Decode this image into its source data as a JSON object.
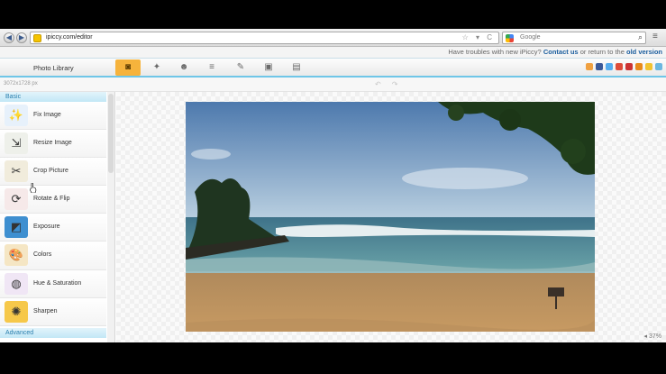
{
  "browser": {
    "back": "◀",
    "forward": "▶",
    "url": "ipiccy.com/editor",
    "url_icons": "☆ ▾ C",
    "search_placeholder": "Google",
    "menu": "≡"
  },
  "notice": {
    "prefix": "Have troubles with new iPiccy?",
    "contact": "Contact us",
    "middle": "or return to the",
    "old_version": "old version"
  },
  "toolbar": {
    "photo_library": "Photo Library",
    "tools": [
      {
        "icon": "camera-icon",
        "glyph": "◙"
      },
      {
        "icon": "magic-wand-icon",
        "glyph": "✦"
      },
      {
        "icon": "person-icon",
        "glyph": "☻"
      },
      {
        "icon": "layers-icon",
        "glyph": "≡"
      },
      {
        "icon": "stickers-icon",
        "glyph": "✎"
      },
      {
        "icon": "frame-icon",
        "glyph": "▣"
      },
      {
        "icon": "save-icon",
        "glyph": "▤"
      }
    ],
    "social_colors": [
      "#f0a040",
      "#3b5998",
      "#55acee",
      "#dd4b39",
      "#d44",
      "#e88a1a",
      "#f2c330",
      "#6bb7e0"
    ]
  },
  "info": {
    "dimensions": "3072x1728 px",
    "undo": "↶",
    "redo": "↷"
  },
  "sidebar": {
    "basic_label": "Basic",
    "advanced_label": "Advanced",
    "items": [
      {
        "label": "Fix Image",
        "icon": "sparkle-icon",
        "glyph": "✨",
        "bg": "#e7f1fb"
      },
      {
        "label": "Resize Image",
        "icon": "resize-icon",
        "glyph": "⇲",
        "bg": "#eef0ea"
      },
      {
        "label": "Crop Picture",
        "icon": "crop-icon",
        "glyph": "✂",
        "bg": "#f1ecdc"
      },
      {
        "label": "Rotate & Flip",
        "icon": "rotate-icon",
        "glyph": "⟳",
        "bg": "#f6e9e9"
      },
      {
        "label": "Exposure",
        "icon": "exposure-icon",
        "glyph": "◩",
        "bg": "#3e8fd0"
      },
      {
        "label": "Colors",
        "icon": "palette-icon",
        "glyph": "🎨",
        "bg": "#f5e6c4"
      },
      {
        "label": "Hue & Saturation",
        "icon": "color-wheel-icon",
        "glyph": "◍",
        "bg": "#f0e6f5"
      },
      {
        "label": "Sharpen",
        "icon": "sharpen-icon",
        "glyph": "✺",
        "bg": "#f6c84a"
      }
    ]
  },
  "canvas": {
    "zoom": "◂ 37%"
  }
}
